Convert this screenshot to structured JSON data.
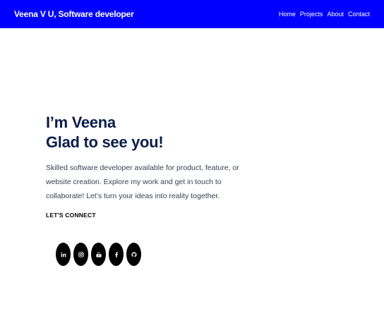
{
  "nav": {
    "brand": "Veena V U, Software developer",
    "links": [
      {
        "label": "Home"
      },
      {
        "label": "Projects"
      },
      {
        "label": "About"
      },
      {
        "label": "Contact"
      }
    ]
  },
  "hero": {
    "line1": "I’m Veena",
    "line2": "Glad to see you!",
    "description": "Skilled software developer available for product, feature, or website creation. Explore my work and get in touch to collaborate! Let’s turn your ideas into reality together.",
    "connect_heading": "LET'S CONNECT"
  },
  "socials": [
    "linkedin-icon",
    "instagram-icon",
    "youtube-icon",
    "facebook-icon",
    "github-icon"
  ],
  "colors": {
    "navbar": "#0000ff",
    "heading": "#0b1d4a",
    "social_bg": "#000000"
  }
}
